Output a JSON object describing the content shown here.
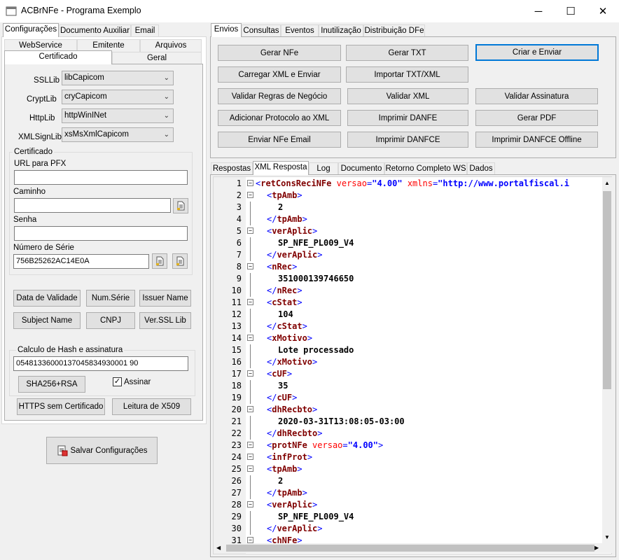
{
  "window": {
    "title": "ACBrNFe - Programa Exemplo",
    "controls": {
      "minimize": "─",
      "maximize": "☐",
      "close": "✕"
    }
  },
  "left": {
    "top_tabs": [
      "Configurações",
      "Documento Auxiliar",
      "Email"
    ],
    "sub_tabs_row1": [
      "WebService",
      "Emitente",
      "Arquivos"
    ],
    "sub_tabs_row2": [
      "Certificado",
      "Geral"
    ],
    "libs": [
      {
        "label": "SSLLib",
        "value": "libCapicom"
      },
      {
        "label": "CryptLib",
        "value": "cryCapicom"
      },
      {
        "label": "HttpLib",
        "value": "httpWinINet"
      },
      {
        "label": "XMLSignLib",
        "value": "xsMsXmlCapicom"
      }
    ],
    "certificado": {
      "group_title": "Certificado",
      "url_label": "URL para PFX",
      "url_value": "",
      "caminho_label": "Caminho",
      "caminho_value": "",
      "senha_label": "Senha",
      "senha_value": "",
      "serie_label": "Número de Série",
      "serie_value": "756B25262AC14E0A"
    },
    "buttons_row1": [
      "Data de Validade",
      "Num.Série",
      "Issuer Name"
    ],
    "buttons_row2": [
      "Subject Name",
      "CNPJ",
      "Ver.SSL Lib"
    ],
    "hash": {
      "group_title": "Calculo de Hash e assinatura",
      "value": "05481336000137045834930001 90",
      "sha_button": "SHA256+RSA",
      "assinar_label": "Assinar",
      "assinar_checked": true
    },
    "https_button": "HTTPS sem Certificado",
    "x509_button": "Leitura de X509",
    "save_button": "Salvar Configurações"
  },
  "right": {
    "top_tabs": [
      "Envios",
      "Consultas",
      "Eventos",
      "Inutilização",
      "Distribuição DFe"
    ],
    "action_buttons": [
      [
        "Gerar NFe",
        "Gerar TXT",
        "Criar e Enviar"
      ],
      [
        "Carregar XML e Enviar",
        "Importar TXT/XML"
      ],
      [
        "Validar Regras de Negócio",
        "Validar XML",
        "Validar Assinatura"
      ],
      [
        "Adicionar Protocolo ao XML",
        "Imprimir DANFE",
        "Gerar PDF"
      ],
      [
        "Enviar NFe Email",
        "Imprimir DANFCE",
        "Imprimir DANFCE Offline"
      ]
    ],
    "result_tabs": [
      "Respostas",
      "XML Resposta",
      "Log",
      "Documento",
      "Retorno Completo WS",
      "Dados"
    ],
    "xml_lines": [
      {
        "n": "1",
        "fold": "−",
        "indent": 0,
        "kind": "root",
        "text": "retConsReciNFe",
        "attr": "versao",
        "val": "\"4.00\"",
        "attr2": "xmlns",
        "val2": "\"http://www.portalfiscal.i"
      },
      {
        "n": "2",
        "fold": "−",
        "indent": 1,
        "kind": "open",
        "text": "tpAmb"
      },
      {
        "n": "3",
        "fold": "",
        "indent": 2,
        "kind": "text",
        "text": "2"
      },
      {
        "n": "4",
        "fold": "",
        "indent": 1,
        "kind": "close",
        "text": "tpAmb"
      },
      {
        "n": "5",
        "fold": "−",
        "indent": 1,
        "kind": "open",
        "text": "verAplic"
      },
      {
        "n": "6",
        "fold": "",
        "indent": 2,
        "kind": "text",
        "text": "SP_NFE_PL009_V4"
      },
      {
        "n": "7",
        "fold": "",
        "indent": 1,
        "kind": "close",
        "text": "verAplic"
      },
      {
        "n": "8",
        "fold": "−",
        "indent": 1,
        "kind": "open",
        "text": "nRec"
      },
      {
        "n": "9",
        "fold": "",
        "indent": 2,
        "kind": "text",
        "text": "351000139746650"
      },
      {
        "n": "10",
        "fold": "",
        "indent": 1,
        "kind": "close",
        "text": "nRec"
      },
      {
        "n": "11",
        "fold": "−",
        "indent": 1,
        "kind": "open",
        "text": "cStat"
      },
      {
        "n": "12",
        "fold": "",
        "indent": 2,
        "kind": "text",
        "text": "104"
      },
      {
        "n": "13",
        "fold": "",
        "indent": 1,
        "kind": "close",
        "text": "cStat"
      },
      {
        "n": "14",
        "fold": "−",
        "indent": 1,
        "kind": "open",
        "text": "xMotivo"
      },
      {
        "n": "15",
        "fold": "",
        "indent": 2,
        "kind": "text",
        "text": "Lote processado"
      },
      {
        "n": "16",
        "fold": "",
        "indent": 1,
        "kind": "close",
        "text": "xMotivo"
      },
      {
        "n": "17",
        "fold": "−",
        "indent": 1,
        "kind": "open",
        "text": "cUF"
      },
      {
        "n": "18",
        "fold": "",
        "indent": 2,
        "kind": "text",
        "text": "35"
      },
      {
        "n": "19",
        "fold": "",
        "indent": 1,
        "kind": "close",
        "text": "cUF"
      },
      {
        "n": "20",
        "fold": "−",
        "indent": 1,
        "kind": "open",
        "text": "dhRecbto"
      },
      {
        "n": "21",
        "fold": "",
        "indent": 2,
        "kind": "text",
        "text": "2020-03-31T13:08:05-03:00"
      },
      {
        "n": "22",
        "fold": "",
        "indent": 1,
        "kind": "close",
        "text": "dhRecbto"
      },
      {
        "n": "23",
        "fold": "−",
        "indent": 1,
        "kind": "openattr",
        "text": "protNFe",
        "attr": "versao",
        "val": "\"4.00\""
      },
      {
        "n": "24",
        "fold": "−",
        "indent": 1,
        "kind": "open",
        "text": "infProt"
      },
      {
        "n": "25",
        "fold": "−",
        "indent": 1,
        "kind": "open",
        "text": "tpAmb"
      },
      {
        "n": "26",
        "fold": "",
        "indent": 2,
        "kind": "text",
        "text": "2"
      },
      {
        "n": "27",
        "fold": "",
        "indent": 1,
        "kind": "close",
        "text": "tpAmb"
      },
      {
        "n": "28",
        "fold": "−",
        "indent": 1,
        "kind": "open",
        "text": "verAplic"
      },
      {
        "n": "29",
        "fold": "",
        "indent": 2,
        "kind": "text",
        "text": "SP_NFE_PL009_V4"
      },
      {
        "n": "30",
        "fold": "",
        "indent": 1,
        "kind": "close",
        "text": "verAplic"
      },
      {
        "n": "31",
        "fold": "−",
        "indent": 1,
        "kind": "open",
        "text": "chNFe"
      }
    ]
  },
  "colors": {
    "accent": "#0078d7",
    "tag": "#800000",
    "bracket": "#0000ff",
    "attr": "#ff0000"
  }
}
